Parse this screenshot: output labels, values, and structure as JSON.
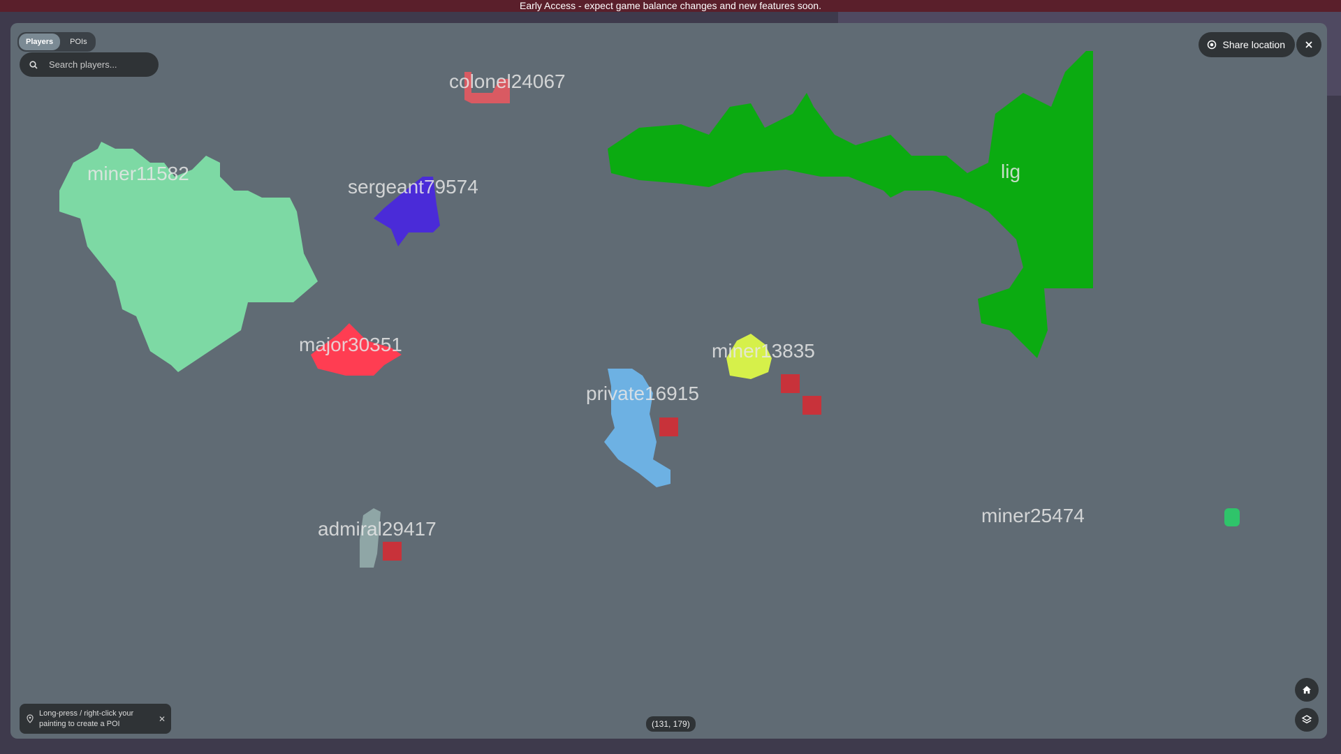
{
  "banner": {
    "text": "Early Access - expect game balance changes and new features soon."
  },
  "tabs": [
    {
      "label": "Players",
      "active": true
    },
    {
      "label": "POIs",
      "active": false
    }
  ],
  "search": {
    "placeholder": "Search players..."
  },
  "share": {
    "label": "Share location"
  },
  "players": [
    {
      "name": "miner11582",
      "color": "#7dd9a4"
    },
    {
      "name": "colonel24067",
      "color": "#d95a62"
    },
    {
      "name": "sergeant79574",
      "color": "#4a2bd8"
    },
    {
      "name": "major30351",
      "color": "#ff3d52"
    },
    {
      "name": "admiral29417",
      "color": "#8fa6a6"
    },
    {
      "name": "private16915",
      "color": "#6db1e3"
    },
    {
      "name": "miner13835",
      "color": "#d6f04a"
    },
    {
      "name": "lig",
      "color": "#0bab11"
    },
    {
      "name": "miner25474",
      "color": "#2fc46a"
    }
  ],
  "coordinates": "(131, 179)",
  "hint": {
    "text": "Long-press / right-click your painting to create a POI"
  },
  "icons": {
    "search": "search-icon",
    "share": "location-target-icon",
    "close": "close-icon",
    "home": "home-icon",
    "layers": "layers-icon",
    "pin": "pin-icon"
  },
  "colors": {
    "map_bg": "#606b74",
    "poi_marker": "#c8323a"
  }
}
